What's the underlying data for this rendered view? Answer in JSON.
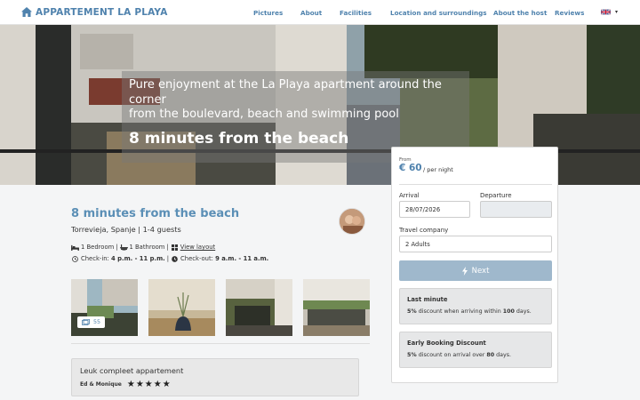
{
  "brand": {
    "name": "APPARTEMENT LA PLAYA",
    "icon": "home-icon"
  },
  "nav": {
    "items": [
      "Pictures",
      "About",
      "Facilities",
      "Location and surroundings",
      "About the host",
      "Reviews"
    ],
    "language": {
      "icon": "uk-flag-icon",
      "caret": "▾"
    }
  },
  "hero": {
    "subtitle_line1": "Pure enjoyment at the La Playa apartment around the corner",
    "subtitle_line2": "from the boulevard, beach and swimming pool",
    "title": "8 minutes from the beach"
  },
  "listing": {
    "title": "8 minutes from the beach",
    "location": "Torrevieja, Spanje | 1-4 guests",
    "bedroom": "1 Bedroom",
    "bathroom": "1 Bathroom",
    "layout_link": "View layout",
    "checkin_label": "Check-in:",
    "checkin_time": "4 p.m. - 11 p.m.",
    "checkout_label": "Check-out:",
    "checkout_time": "9 a.m. - 11 a.m.",
    "photo_count": "55"
  },
  "review": {
    "text": "Leuk compleet appartement",
    "author": "Ed & Monique",
    "stars": "★★★★★",
    "rating": 5
  },
  "booking": {
    "from_label": "From",
    "price": "€ 60",
    "per_night": "/ per night",
    "arrival_label": "Arrival",
    "arrival_value": "28/07/2026",
    "departure_label": "Departure",
    "departure_value": "",
    "company_label": "Travel company",
    "company_value": "2 Adults",
    "next_label": "Next",
    "promos": [
      {
        "title": "Last minute",
        "pct": "5%",
        "mid": " discount when arriving within ",
        "num": "100",
        "end": " days."
      },
      {
        "title": "Early Booking Discount",
        "pct": "5%",
        "mid": " discount on arrival over ",
        "num": "80",
        "end": " days."
      }
    ]
  },
  "colors": {
    "brand": "#4f82ad",
    "title": "#5b8fb6",
    "button": "#9fb8cc"
  }
}
